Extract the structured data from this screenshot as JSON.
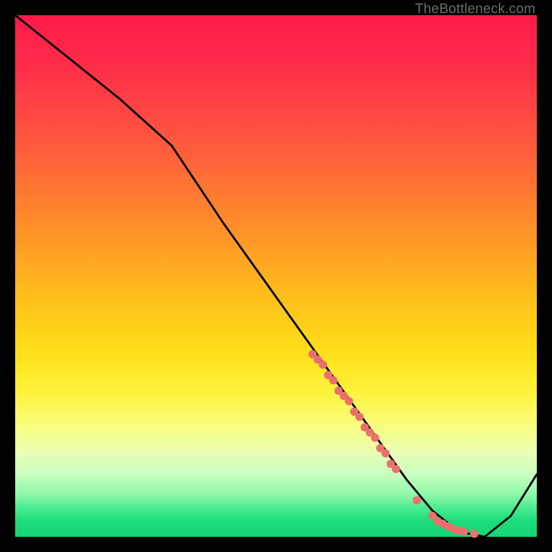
{
  "watermark": "TheBottleneck.com",
  "colors": {
    "curve": "#000000",
    "marker_fill": "#e9716d",
    "marker_stroke": "#e9716d"
  },
  "chart_data": {
    "type": "line",
    "title": "",
    "xlabel": "",
    "ylabel": "",
    "xlim": [
      0,
      100
    ],
    "ylim": [
      0,
      100
    ],
    "x": [
      0,
      10,
      20,
      30,
      40,
      50,
      60,
      70,
      75,
      80,
      85,
      90,
      95,
      100
    ],
    "values": [
      100,
      92,
      84,
      75,
      60,
      46,
      32,
      18,
      11,
      5,
      1,
      0,
      4,
      12
    ],
    "series": [
      {
        "name": "highlighted-points",
        "type": "scatter",
        "x": [
          57,
          58,
          59,
          60,
          61,
          62,
          63,
          64,
          65,
          66,
          67,
          68,
          69,
          70,
          71,
          72,
          73,
          77,
          80,
          81,
          82,
          83,
          84,
          85,
          86,
          88
        ],
        "values": [
          35,
          34,
          33,
          31,
          30,
          28,
          27,
          26,
          24,
          23,
          21,
          20,
          19,
          17,
          16,
          14,
          13,
          7,
          4,
          3,
          2.5,
          2,
          1.5,
          1.2,
          1,
          0.6
        ]
      }
    ],
    "notes": "Axes carry no visible tick labels; values are estimated on a 0–100 normalized scale from plot geometry."
  }
}
